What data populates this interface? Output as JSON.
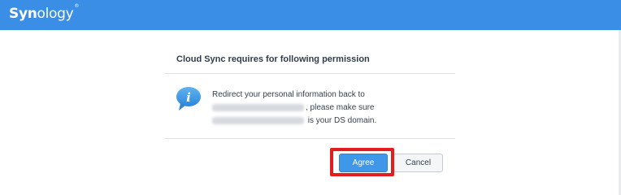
{
  "header": {
    "brand_bold": "Syn",
    "brand_light": "ology",
    "brand_mark": "®",
    "brand_color": "#3a8ee6"
  },
  "dialog": {
    "title": "Cloud Sync requires for following permission",
    "icon": "info-speech-bubble-icon",
    "message": {
      "line1": "Redirect your personal information back to",
      "line2_suffix": ", please make sure",
      "line3_suffix": " is your DS domain."
    },
    "agree_label": "Agree",
    "cancel_label": "Cancel",
    "accent_color": "#3f97ea",
    "highlight_color": "#e11d1d"
  }
}
